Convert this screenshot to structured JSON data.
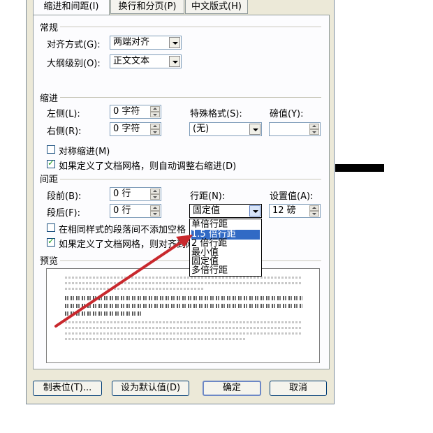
{
  "tabs": [
    "缩进和间距(I)",
    "换行和分页(P)",
    "中文版式(H)"
  ],
  "general": {
    "title": "常规",
    "alignment_label": "对齐方式(G):",
    "alignment_value": "两端对齐",
    "outline_label": "大纲级别(O):",
    "outline_value": "正文文本"
  },
  "indent": {
    "title": "缩进",
    "left_label": "左侧(L):",
    "left_value": "0 字符",
    "right_label": "右侧(R):",
    "right_value": "0 字符",
    "special_label": "特殊格式(S):",
    "special_value": "(无)",
    "by_label": "磅值(Y):",
    "by_value": "",
    "mirror_label": "对称缩进(M)",
    "mirror_checked": false,
    "auto_adjust_label": "如果定义了文档网格，则自动调整右缩进(D)",
    "auto_adjust_checked": true
  },
  "spacing": {
    "title": "间距",
    "before_label": "段前(B):",
    "before_value": "0 行",
    "after_label": "段后(F):",
    "after_value": "0 行",
    "line_label": "行距(N):",
    "line_value": "固定值",
    "at_label": "设置值(A):",
    "at_value": "12 磅",
    "no_space_label": "在相同样式的段落间不添加空格",
    "no_space_checked": false,
    "snap_label": "如果定义了文档网格，则对齐到网格",
    "snap_checked": true
  },
  "line_spacing_options": [
    "单倍行距",
    "1.5 倍行距",
    "2 倍行距",
    "最小值",
    "固定值",
    "多倍行距"
  ],
  "line_spacing_highlighted": "1.5 倍行距",
  "preview": {
    "title": "预览"
  },
  "buttons": {
    "tabs": "制表位(T)...",
    "default": "设为默认值(D)",
    "ok": "确定",
    "cancel": "取消"
  },
  "colors": {
    "annotation_arrow": "#c8282d",
    "selection": "#316ac5"
  }
}
